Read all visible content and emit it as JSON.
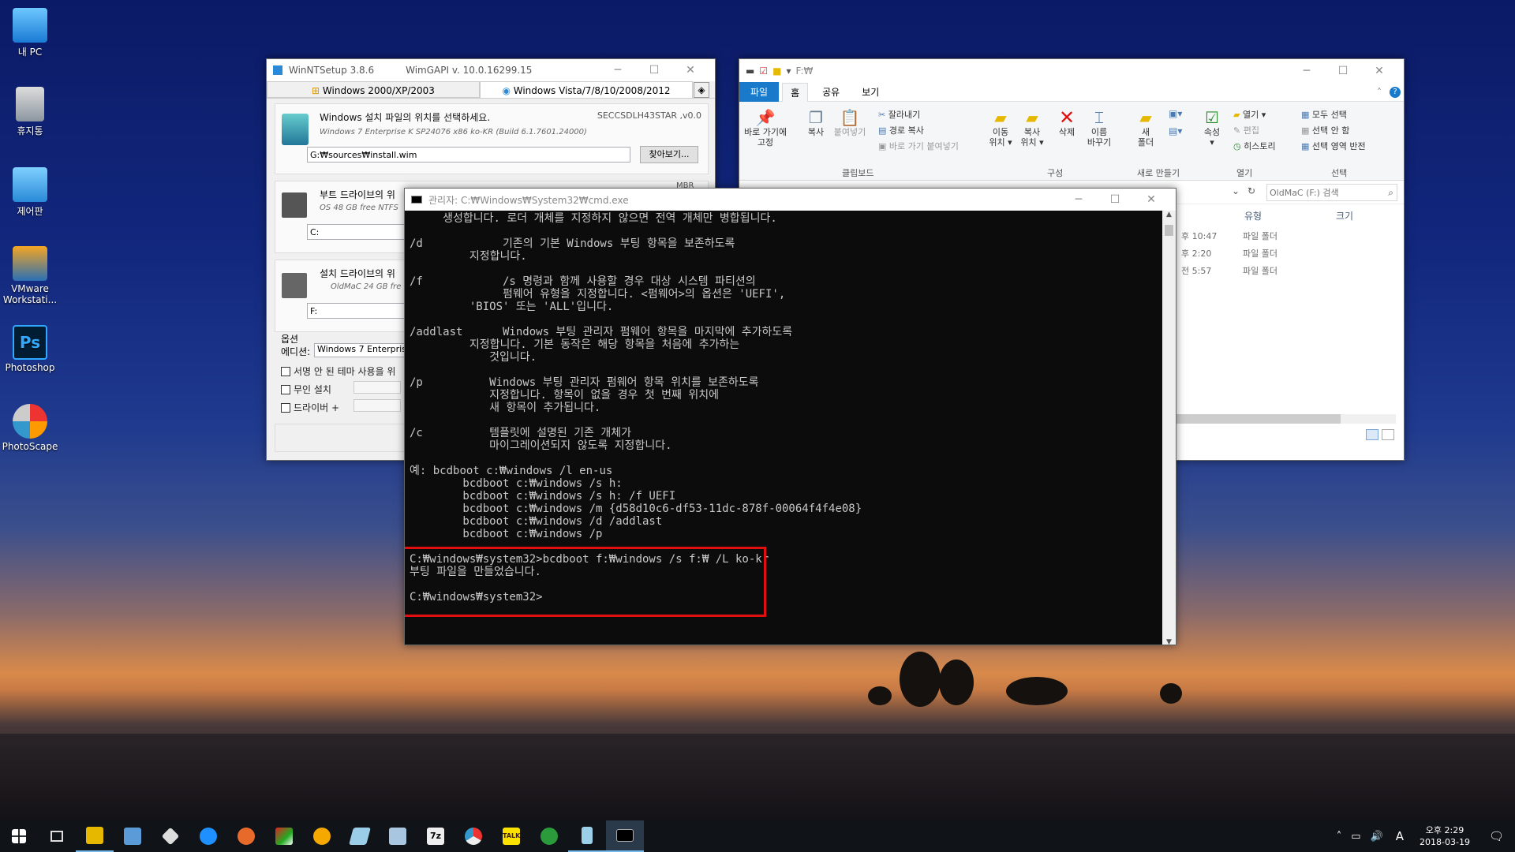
{
  "desktop": {
    "icons": [
      {
        "label": "내 PC"
      },
      {
        "label": "휴지통"
      },
      {
        "label": "제어판"
      },
      {
        "label": "VMware Workstati..."
      },
      {
        "label": "Photoshop"
      },
      {
        "label": "PhotoScape"
      }
    ]
  },
  "winntsetup": {
    "title": "WinNTSetup 3.8.6",
    "wimgapi": "WimGAPI v. 10.0.16299.15",
    "tab_xp": "Windows 2000/XP/2003",
    "tab_vista": "Windows Vista/7/8/10/2008/2012",
    "source_label": "Windows 설치 파일의 위치를 선택하세요.",
    "source_id": "SECCSDLH43STAR ,v0.0",
    "source_info": "Windows 7 Enterprise K SP24076 x86 ko-KR (Build 6.1.7601.24000)",
    "source_path": "G:₩sources₩install.wim",
    "browse_label": "찾아보기...",
    "boot_label": "부트 드라이브의 위",
    "boot_info": "OS 48 GB free NTFS",
    "boot_drive": "C:",
    "mbr": "MBR",
    "install_label": "설치 드라이브의 위",
    "install_info": "OldMaC 24 GB fre",
    "install_drive": "F:",
    "options_label": "옵션",
    "edition_label": "에디션:",
    "edition_value": "Windows 7 Enterpris",
    "opt1": "서명 안 된 테마 사용을 위",
    "opt2": "무인 설치",
    "opt3": "드라이버 +"
  },
  "explorer": {
    "path": "F:₩",
    "tabs": [
      "파일",
      "홈",
      "공유",
      "보기"
    ],
    "ribbon": {
      "pin": "바로 가기에\n고정",
      "copy": "복사",
      "paste": "붙여넣기",
      "cut": "잘라내기",
      "copy_path": "경로 복사",
      "paste_shortcut": "바로 가기 붙여넣기",
      "clipboard": "클립보드",
      "move": "이동\n위치 ▾",
      "copyto": "복사\n위치 ▾",
      "delete": "삭제",
      "rename": "이름\n바꾸기",
      "organize": "구성",
      "newfolder": "새\n폴더",
      "new": "새로 만들기",
      "props": "속성",
      "open": "열기 ▾",
      "edit": "편집",
      "history": "히스토리",
      "open_grp": "열기",
      "selall": "모두 선택",
      "selnone": "선택 안 함",
      "selinv": "선택 영역 반전",
      "select": "선택"
    },
    "search_placeholder": "OldMaC (F:) 검색",
    "col_type": "유형",
    "col_size": "크기",
    "rows": [
      {
        "time": "후 10:47",
        "type": "파일 폴더"
      },
      {
        "time": "후 2:20",
        "type": "파일 폴더"
      },
      {
        "time": "전 5:57",
        "type": "파일 폴더"
      }
    ]
  },
  "cmd": {
    "title": "관리자: C:₩Windows₩System32₩cmd.exe",
    "lines": [
      "     생성합니다. 로더 개체를 지정하지 않으면 전역 개체만 병합됩니다.",
      "",
      "/d            기존의 기본 Windows 부팅 항목을 보존하도록",
      "         지정합니다.",
      "",
      "/f            /s 명령과 함께 사용할 경우 대상 시스템 파티션의",
      "              펌웨어 유형을 지정합니다. <펌웨어>의 옵션은 'UEFI',",
      "         'BIOS' 또는 'ALL'입니다.",
      "",
      "/addlast      Windows 부팅 관리자 펌웨어 항목을 마지막에 추가하도록",
      "         지정합니다. 기본 동작은 해당 항목을 처음에 추가하는",
      "            것입니다.",
      "",
      "/p          Windows 부팅 관리자 펌웨어 항목 위치를 보존하도록",
      "            지정합니다. 항목이 없을 경우 첫 번째 위치에",
      "            새 항목이 추가됩니다.",
      "",
      "/c          템플릿에 설명된 기존 개체가",
      "            마이그레이션되지 않도록 지정합니다.",
      "",
      "예: bcdboot c:₩windows /l en-us",
      "        bcdboot c:₩windows /s h:",
      "        bcdboot c:₩windows /s h: /f UEFI",
      "        bcdboot c:₩windows /m {d58d10c6-df53-11dc-878f-00064f4f4e08}",
      "        bcdboot c:₩windows /d /addlast",
      "        bcdboot c:₩windows /p",
      "",
      "C:₩windows₩system32>bcdboot f:₩windows /s f:₩ /L ko-kr",
      "부팅 파일을 만들었습니다.",
      "",
      "C:₩windows₩system32>"
    ]
  },
  "taskbar": {
    "time": "오후 2:29",
    "date": "2018-03-19",
    "ime": "A"
  },
  "colors": {
    "accent": "#1979ca",
    "highlight": "#e01010"
  }
}
